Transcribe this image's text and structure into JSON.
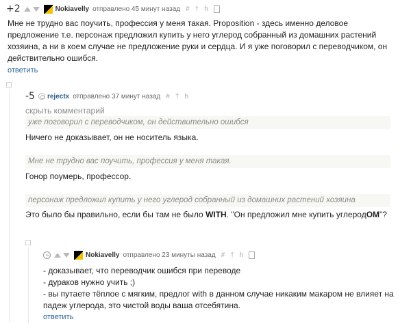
{
  "comment1": {
    "score": "+2",
    "username": "Nokiavelly",
    "posted": "отправлено 45 минут назад",
    "tools": [
      "#",
      "†",
      "h",
      "B"
    ],
    "lines": [
      "Мне не трудно вас поучить, профессия у меня такая.  Proposition - здесь именно деловое",
      "предложение т.е. персонаж предложил купить у него углерод собранный из домашних растений",
      "хозяина, а ни в коем случае не предложение руки и сердца. И я уже поговорил с переводчиком, он",
      "действительно ошибся."
    ],
    "reply": "ответить"
  },
  "comment2": {
    "score": "-5",
    "username": "rejectx",
    "posted": "отправлено 37 минут назад",
    "tools": [
      "#",
      "†",
      "h"
    ],
    "hide": "скрыть комментарий",
    "quote1": "уже поговорил с переводчиком, он действительно ошибся",
    "text1": "Ничего не доказывает, он не носитель языка.",
    "quote2": "Мне не трудно вас поучить, профессия у меня такая.",
    "text2": "Гонор поумерь, профессор.",
    "quote3": "персонаж предложил купить у него углерод собранный из домашних растений хозяина",
    "text3_before": "Это было бы правильно, если бы там не было ",
    "text3_bold": "WITH",
    "text3_mid": ". \"Он предложил мне купить углерод",
    "text3_bold2": "ОМ",
    "text3_end": "\"?"
  },
  "comment3": {
    "username": "Nokiavelly",
    "posted": "отправлено 23 минуты назад",
    "tools": [
      "#",
      "†",
      "h"
    ],
    "lines": [
      "- доказывает, что переводчик ошибся при переводе",
      "- дураков нужно учить ;)",
      "- вы путаете тёплое с мягким, предлог with в данном случае никаким макаром не влияет на",
      "падеж углерода, это чистой воды ваша отсебятина."
    ],
    "reply": "ответить"
  }
}
